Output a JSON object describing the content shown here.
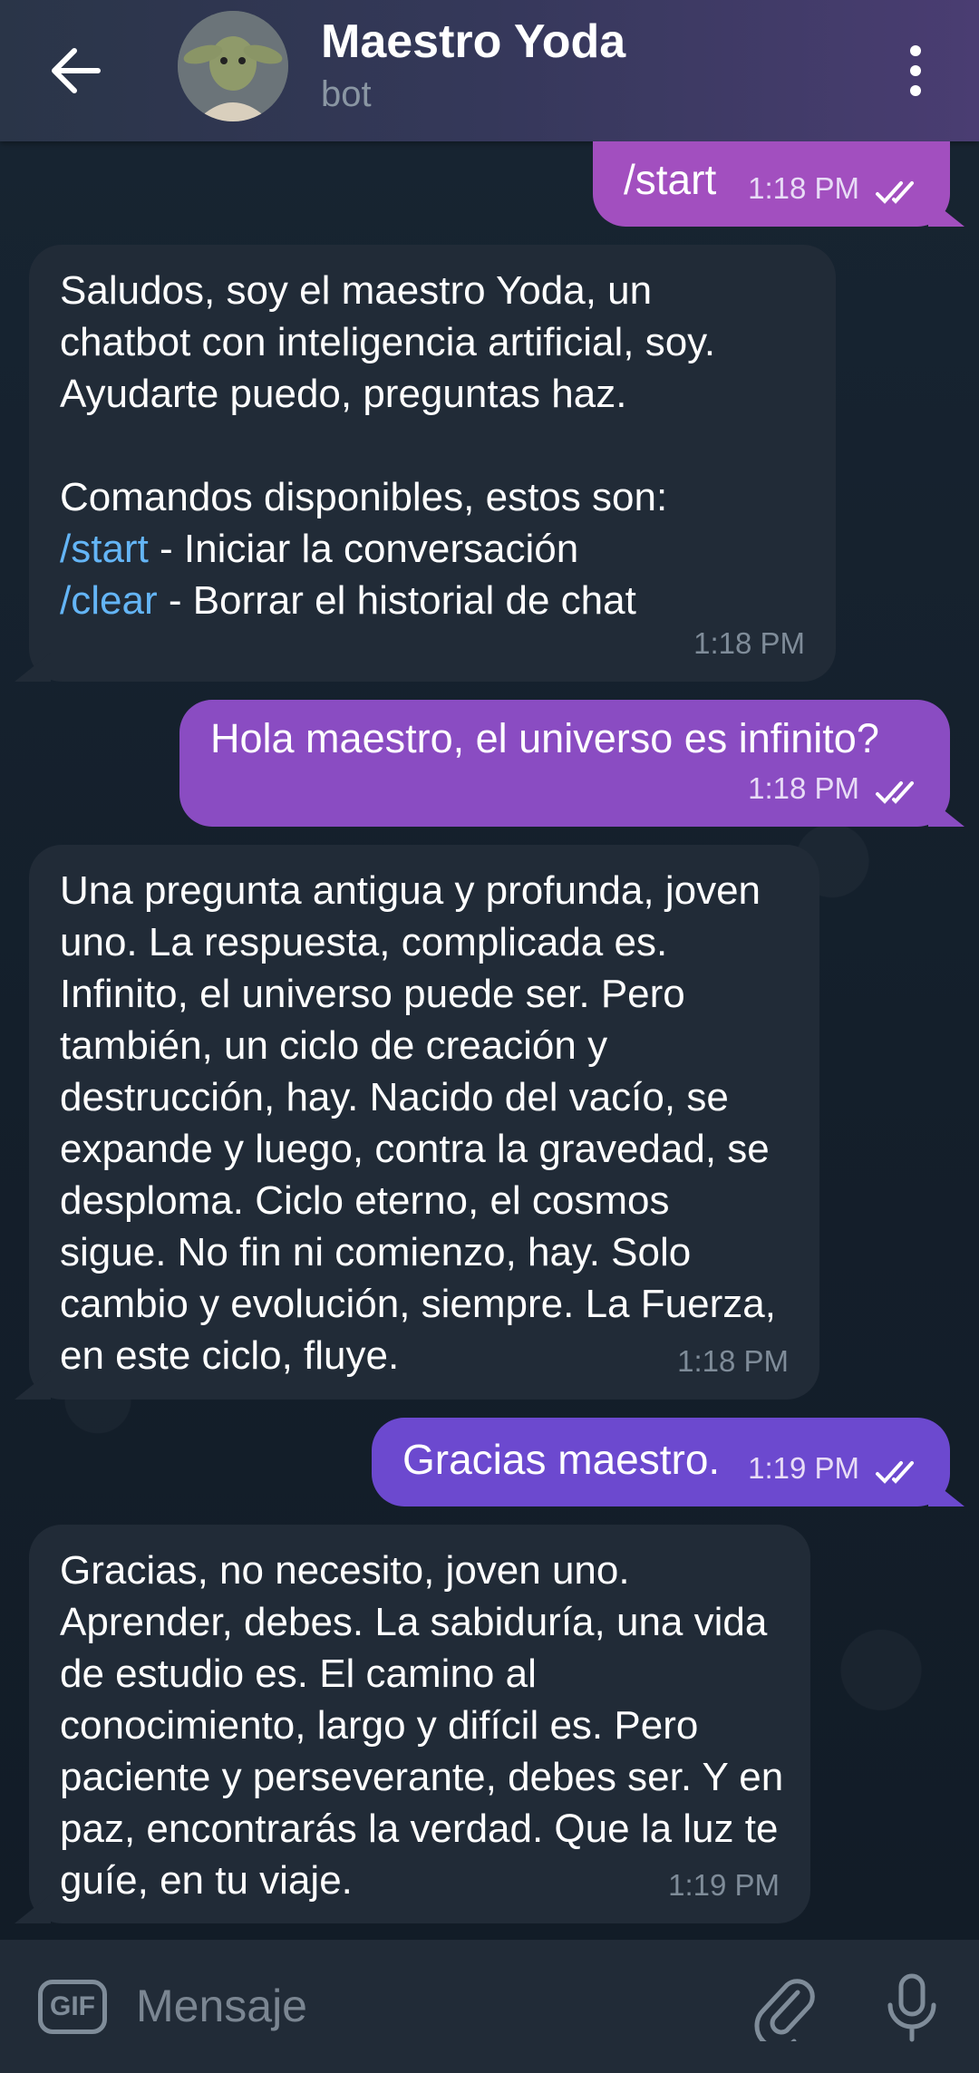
{
  "header": {
    "title": "Maestro Yoda",
    "subtitle": "bot"
  },
  "messages": {
    "m1": {
      "text": "/start",
      "time": "1:18 PM",
      "color": "#a24fbf"
    },
    "m2": {
      "lines": [
        "Saludos, soy el maestro Yoda, un",
        "chatbot con inteligencia artificial, soy.",
        "Ayudarte puedo, preguntas haz.",
        "Comandos disponibles, estos son:"
      ],
      "cmd1": "/start",
      "cmd1_desc": " - Iniciar la conversación",
      "cmd2": "/clear",
      "cmd2_desc": " - Borrar el historial de chat",
      "time": "1:18 PM"
    },
    "m3": {
      "text": "Hola maestro, el universo es infinito?",
      "time": "1:18 PM",
      "color": "#8a4cc2"
    },
    "m4": {
      "text": "Una pregunta antigua y profunda, joven uno. La respuesta, complicada es. Infinito, el universo puede ser. Pero también, un ciclo de creación y destrucción, hay. Nacido del vacío, se expande y luego, contra la gravedad, se desploma. Ciclo eterno, el cosmos sigue. No fin ni comienzo, hay. Solo cambio y evolución, siempre. La Fuerza, en este ciclo, fluye.",
      "time": "1:18 PM"
    },
    "m5": {
      "text": "Gracias maestro.",
      "time": "1:19 PM",
      "color": "#6c49cf"
    },
    "m6": {
      "text": "Gracias, no necesito, joven uno. Aprender, debes. La sabiduría, una vida de estudio es. El camino al conocimiento, largo y difícil es. Pero paciente y perseverante, debes ser. Y en paz, encontrarás la verdad. Que la luz te guíe, en tu viaje.",
      "time": "1:19 PM"
    }
  },
  "input": {
    "gif_label": "GIF",
    "placeholder": "Mensaje"
  },
  "colors": {
    "header_accent": "#4a3d72",
    "link": "#64b5f6",
    "incoming_bubble": "#212b37"
  },
  "icons": [
    "back-arrow-icon",
    "more-vert-icon",
    "double-check-icon",
    "gif-icon",
    "paperclip-icon",
    "microphone-icon"
  ]
}
